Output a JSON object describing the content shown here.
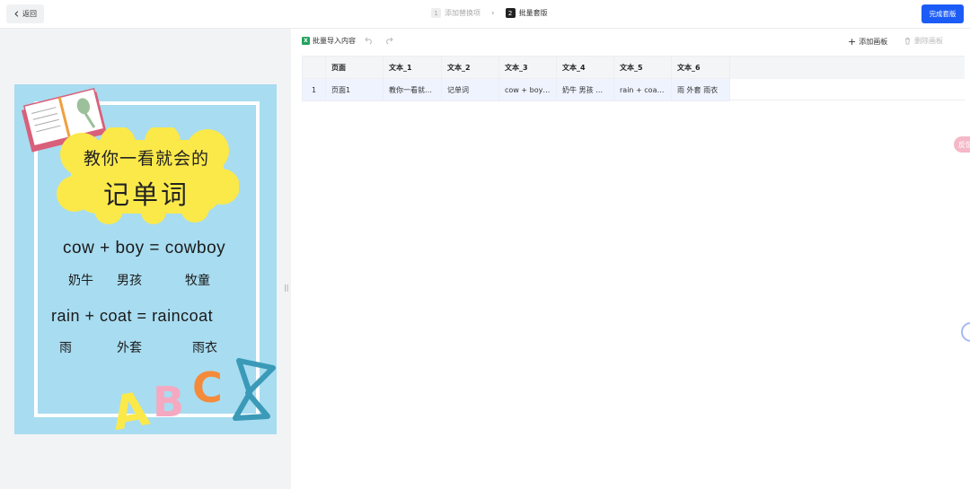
{
  "topbar": {
    "back_label": "返回",
    "steps": [
      {
        "num": "1",
        "label": "添加替换项"
      },
      {
        "num": "2",
        "label": "批量套版"
      }
    ],
    "finish_label": "完成套版"
  },
  "toolbar": {
    "import_label": "批量导入内容",
    "add_board_label": "添加画板",
    "delete_board_label": "删除画板"
  },
  "table": {
    "headers": [
      "",
      "页面",
      "文本_1",
      "文本_2",
      "文本_3",
      "文本_4",
      "文本_5",
      "文本_6"
    ],
    "rows": [
      [
        "1",
        "页面1",
        "教你一看就会的",
        "记单词",
        "cow + boy = ...",
        "奶牛 男孩 牧童",
        "rain + coat = ...",
        "雨 外套 雨衣"
      ]
    ]
  },
  "poster": {
    "title1": "教你一看就会的",
    "title2": "记单词",
    "line1": "cow + boy = cowboy",
    "line2": [
      "奶牛",
      "男孩",
      "牧童"
    ],
    "line3": "rain + coat = raincoat",
    "line4": [
      "雨",
      "外套",
      "雨衣"
    ],
    "letters": "ABC"
  },
  "side": {
    "pill_label": "反馈"
  },
  "colors": {
    "accent": "#1c5cf6",
    "poster_bg": "#a8dcf0",
    "cloud": "#fbe94a",
    "row_highlight": "#eef3fd"
  }
}
